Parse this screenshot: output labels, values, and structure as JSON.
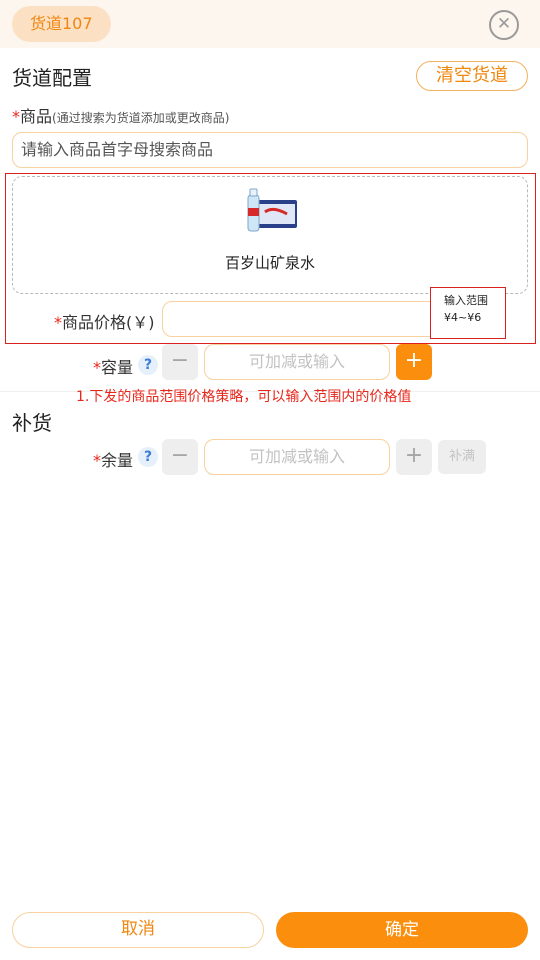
{
  "header": {
    "channel_chip": "货道107",
    "close_icon": "close-circle-icon"
  },
  "config": {
    "title": "货道配置",
    "clear_button": "清空货道",
    "product_label": "商品",
    "product_hint": "(通过搜索为货道添加或更改商品)",
    "search_placeholder": "请输入商品首字母搜索商品",
    "product": {
      "name": "百岁山矿泉水",
      "image_icon": "water-bottle-product-image"
    },
    "price_label": "商品价格(￥)",
    "price_value": "",
    "range_tip_title": "输入范围",
    "range_tip_value": "¥4~¥6",
    "capacity_label": "容量",
    "capacity_placeholder": "可加减或输入"
  },
  "annotation_text": "1.下发的商品范围价格策略，可以输入范围内的价格值",
  "restock": {
    "title": "补货",
    "stock_label": "余量",
    "stock_placeholder": "可加减或输入",
    "fill_button": "补满"
  },
  "footer": {
    "cancel": "取消",
    "confirm": "确定"
  },
  "colors": {
    "accent": "#fb8f0d",
    "accent_text": "#f0870f",
    "required": "#e8271b",
    "highlight_box": "#d9221e"
  }
}
